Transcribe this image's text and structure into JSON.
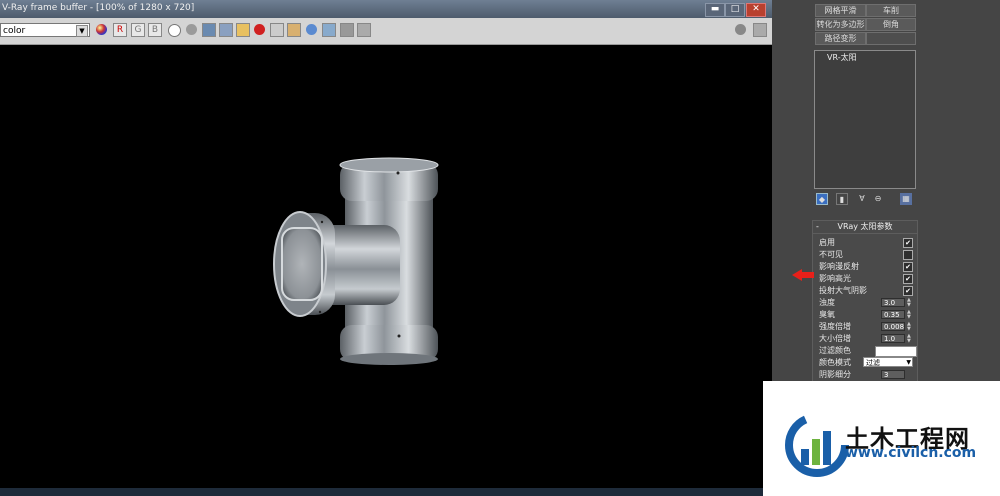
{
  "vfb": {
    "title": "V-Ray frame buffer - [100% of 1280 x 720]",
    "channel": "color",
    "window_buttons": {
      "minimize": "▬",
      "maximize": "□",
      "close": "✕"
    },
    "channel_buttons": {
      "r": "R",
      "g": "G",
      "b": "B"
    }
  },
  "panel": {
    "top_buttons": [
      {
        "label": "网格平滑"
      },
      {
        "label": "车削"
      },
      {
        "label": "转化为多边形"
      },
      {
        "label": "倒角"
      },
      {
        "label": "路径变形"
      }
    ],
    "sun_list_item": "VR-太阳",
    "rollout": {
      "title": "VRay 太阳参数",
      "minus": "-",
      "checks": [
        {
          "label": "启用",
          "checked": true,
          "mark": "✔"
        },
        {
          "label": "不可见",
          "checked": false,
          "mark": ""
        },
        {
          "label": "影响漫反射",
          "checked": true,
          "mark": "✔"
        },
        {
          "label": "影响高光",
          "checked": true,
          "mark": "✔"
        },
        {
          "label": "投射大气阴影",
          "checked": true,
          "mark": "✔"
        }
      ],
      "spinners": [
        {
          "label": "浊度",
          "value": "3.0"
        },
        {
          "label": "臭氧",
          "value": "0.35"
        },
        {
          "label": "强度倍增",
          "value": "0.008"
        },
        {
          "label": "大小倍增",
          "value": "1.0"
        }
      ],
      "filter_color_label": "过滤颜色",
      "filter_color": "#ffffff",
      "color_mode_label": "颜色模式",
      "color_mode_value": "过滤",
      "shadow_subdivs_label": "阴影细分",
      "shadow_subdivs_value": "3"
    }
  },
  "watermark": {
    "name": "土木工程网",
    "url": "www.civilcn.com"
  },
  "colors": {
    "accent_red": "#e8201a",
    "wm_blue": "#1a5fa8",
    "wm_green": "#6db33f"
  }
}
